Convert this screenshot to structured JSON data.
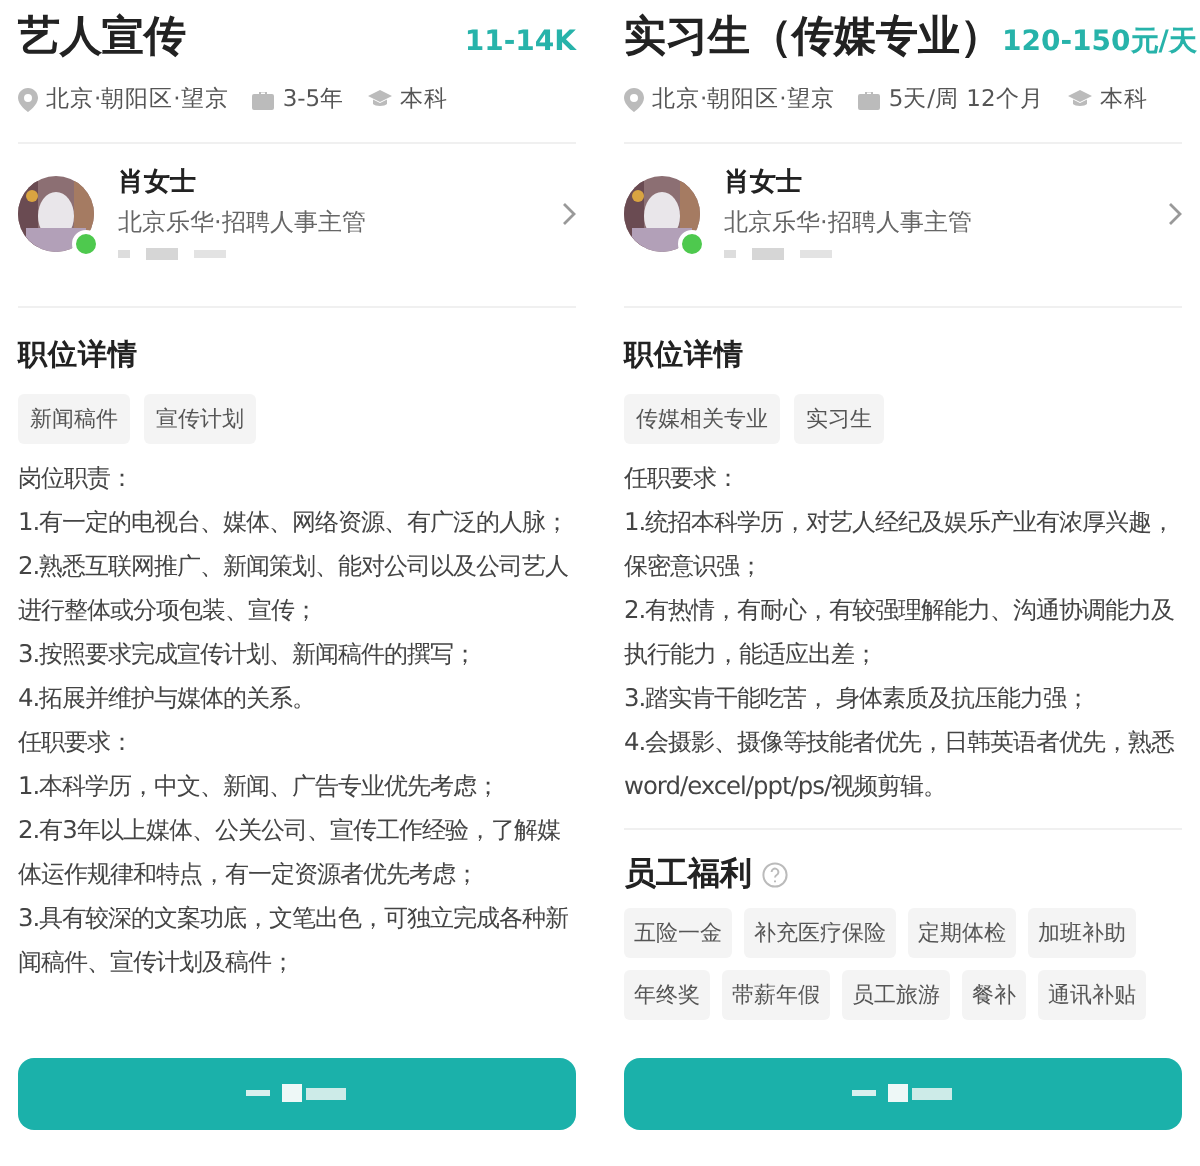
{
  "panels": [
    {
      "title": "艺人宣传",
      "salary": "11-14K",
      "meta": [
        {
          "kind": "location",
          "text": "北京·朝阳区·望京"
        },
        {
          "kind": "experience",
          "text": "3-5年"
        },
        {
          "kind": "education",
          "text": "本科"
        }
      ],
      "recruiter": {
        "name": "肖女士",
        "role": "北京乐华·招聘人事主管",
        "online": true
      },
      "details": {
        "heading": "职位详情",
        "tags": [
          "新闻稿件",
          "宣传计划"
        ],
        "paragraphs": [
          "岗位职责：",
          "1.有一定的电视台、媒体、网络资源、有广泛的人脉；",
          "2.熟悉互联网推广、新闻策划、能对公司以及公司艺人进行整体或分项包装、宣传；",
          "3.按照要求完成宣传计划、新闻稿件的撰写；",
          "4.拓展并维护与媒体的关系。",
          "任职要求：",
          "1.本科学历，中文、新闻、广告专业优先考虑；",
          "2.有3年以上媒体、公关公司、宣传工作经验，了解媒体运作规律和特点，有一定资源者优先考虑；",
          "3.具有较深的文案功底，文笔出色，可独立完成各种新闻稿件、宣传计划及稿件；"
        ]
      }
    },
    {
      "title": "实习生（传媒专业）",
      "salary": "120-150元/天",
      "meta": [
        {
          "kind": "location",
          "text": "北京·朝阳区·望京"
        },
        {
          "kind": "experience",
          "text": "5天/周 12个月"
        },
        {
          "kind": "education",
          "text": "本科"
        }
      ],
      "recruiter": {
        "name": "肖女士",
        "role": "北京乐华·招聘人事主管",
        "online": true
      },
      "details": {
        "heading": "职位详情",
        "tags": [
          "传媒相关专业",
          "实习生"
        ],
        "paragraphs": [
          "任职要求：",
          "1.统招本科学历，对艺人经纪及娱乐产业有浓厚兴趣，保密意识强；",
          "2.有热情，有耐心，有较强理解能力、沟通协调能力及执行能力，能适应出差；",
          "3.踏实肯干能吃苦， 身体素质及抗压能力强；",
          "4.会摄影、摄像等技能者优先，日韩英语者优先，熟悉word/excel/ppt/ps/视频剪辑。"
        ]
      },
      "benefits": {
        "heading": "员工福利",
        "tags": [
          "五险一金",
          "补充医疗保险",
          "定期体检",
          "加班补助",
          "年终奖",
          "带薪年假",
          "员工旅游",
          "餐补",
          "通讯补贴"
        ]
      }
    }
  ]
}
